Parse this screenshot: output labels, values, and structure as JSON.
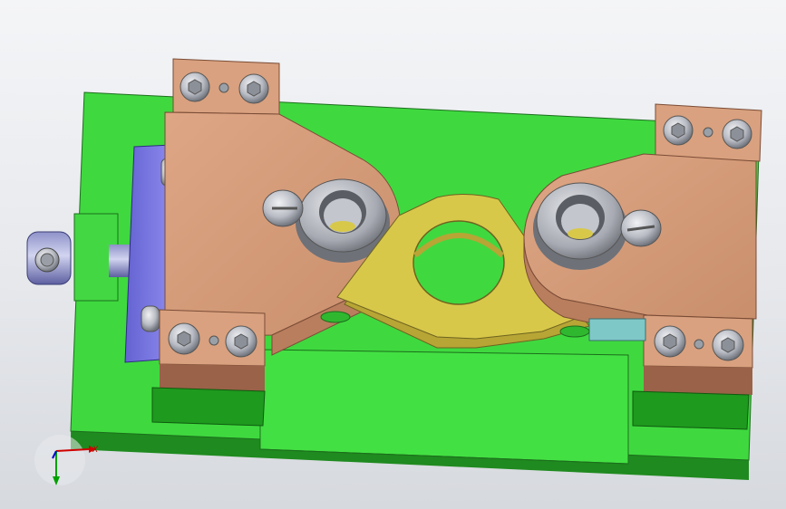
{
  "viewport": {
    "background_top": "#f4f5f7",
    "background_bottom": "#d6d9de"
  },
  "model": {
    "colors": {
      "base_plate": "#3fd93f",
      "base_plate_dark": "#1f8a1f",
      "base_plate_edge": "#2ea82e",
      "clamp_arm": "#d79f7c",
      "clamp_arm_shade": "#b97e5e",
      "clamp_arm_dark": "#9a6248",
      "workpiece": "#d8c84a",
      "workpiece_shade": "#b7a535",
      "block_blue": "#7a78e0",
      "block_blue_dark": "#4c4ab4",
      "steel": "#b9bcc4",
      "steel_dark": "#7c8088"
    }
  },
  "triad": {
    "x_axis_label": "X",
    "x_color": "#d00000",
    "y_color": "#00a000",
    "z_color": "#0000d0"
  }
}
